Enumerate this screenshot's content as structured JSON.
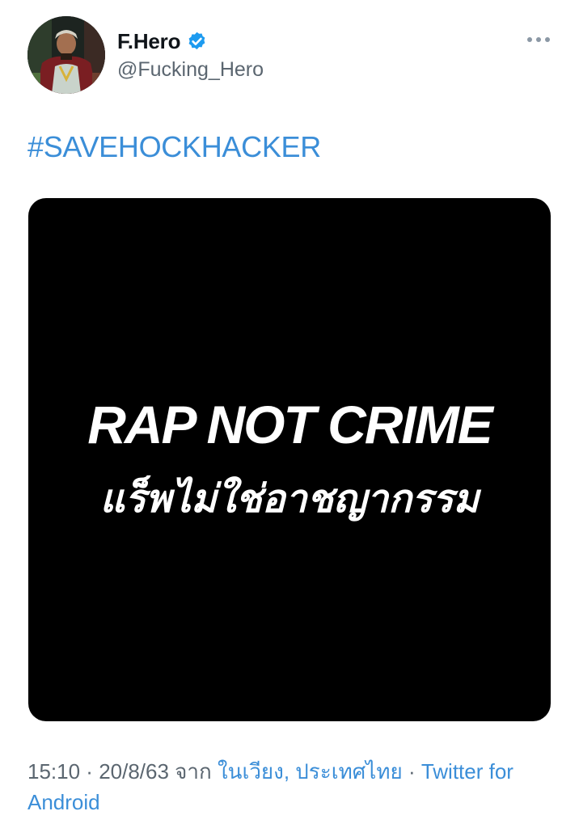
{
  "user": {
    "display_name": "F.Hero",
    "handle": "@Fucking_Hero",
    "verified": true,
    "verified_icon": "verified-badge-icon",
    "avatar_icon": "profile-photo"
  },
  "more_icon": "more-options-icon",
  "tweet": {
    "hashtag": "#SAVEHOCKHACKER",
    "media": {
      "title": "RAP NOT CRIME",
      "subtitle": "แร็พไม่ใช่อาชญากรรม"
    }
  },
  "meta": {
    "time": "15:10",
    "separator1": " · ",
    "date": "20/8/63",
    "from_label": " จาก ",
    "location": "ในเวียง, ประเทศไทย",
    "separator2": " · ",
    "source": "Twitter for Android"
  },
  "colors": {
    "link": "#3b8ed8",
    "secondary_text": "#5b6670",
    "verified": "#1d9bf0"
  }
}
